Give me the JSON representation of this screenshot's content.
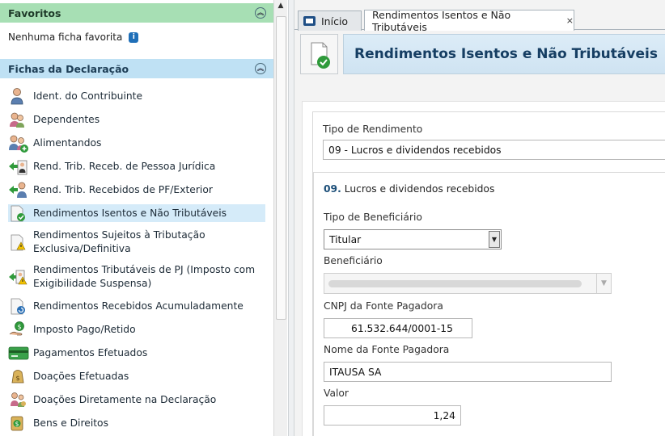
{
  "favorites": {
    "title": "Favoritos",
    "empty_text": "Nenhuma ficha favorita",
    "info_icon": "info-icon"
  },
  "fichas": {
    "title": "Fichas da Declaração",
    "items": [
      {
        "label": "Ident. do Contribuinte",
        "icon": "person-icon"
      },
      {
        "label": "Dependentes",
        "icon": "dependents-icon"
      },
      {
        "label": "Alimentandos",
        "icon": "add-person-icon"
      },
      {
        "label": "Rend. Trib. Receb. de Pessoa Jurídica",
        "icon": "income-pj-icon"
      },
      {
        "label": "Rend. Trib. Recebidos de PF/Exterior",
        "icon": "income-pf-icon"
      },
      {
        "label": "Rendimentos Isentos e Não Tributáveis",
        "icon": "exempt-income-icon"
      },
      {
        "label": "Rendimentos Sujeitos à Tributação Exclusiva/Definitiva",
        "line1": "Rendimentos Sujeitos à Tributação",
        "line2": "Exclusiva/Definitiva",
        "icon": "exclusive-tax-icon"
      },
      {
        "label": "Rendimentos Tributáveis de PJ (Imposto com Exigibilidade Suspensa)",
        "line1": "Rendimentos Tributáveis de PJ (Imposto com",
        "line2": "Exigibilidade Suspensa)",
        "icon": "suspended-tax-icon"
      },
      {
        "label": "Rendimentos Recebidos Acumuladamente",
        "icon": "accumulated-income-icon"
      },
      {
        "label": "Imposto Pago/Retido",
        "icon": "tax-paid-icon"
      },
      {
        "label": "Pagamentos Efetuados",
        "icon": "payments-icon"
      },
      {
        "label": "Doações Efetuadas",
        "icon": "donations-icon"
      },
      {
        "label": "Doações Diretamente na Declaração",
        "icon": "direct-donations-icon"
      },
      {
        "label": "Bens e Direitos",
        "icon": "assets-icon"
      }
    ],
    "active_index": 5
  },
  "tabs": [
    {
      "label": "Início",
      "icon": "home-icon"
    },
    {
      "label": "Rendimentos Isentos e Não Tributáveis",
      "close": "×"
    }
  ],
  "page": {
    "title": "Rendimentos Isentos e Não Tributáveis",
    "tipo_rendimento_label": "Tipo de Rendimento",
    "tipo_rendimento_value": "09 - Lucros e dividendos recebidos",
    "section_number": "09.",
    "section_title": "Lucros e dividendos recebidos",
    "tipo_beneficiario_label": "Tipo de Beneficiário",
    "tipo_beneficiario_value": "Titular",
    "beneficiario_label": "Beneficiário",
    "cnpj_label": "CNPJ da Fonte Pagadora",
    "cnpj_value": "61.532.644/0001-15",
    "nome_fonte_label": "Nome da Fonte Pagadora",
    "nome_fonte_value": "ITAUSA SA",
    "valor_label": "Valor",
    "valor_value": "1,24"
  },
  "colors": {
    "favorites_header": "#a7dfb4",
    "fichas_header": "#bfe1f4",
    "active_item": "#d5ebf9",
    "title_text": "#163e63"
  }
}
